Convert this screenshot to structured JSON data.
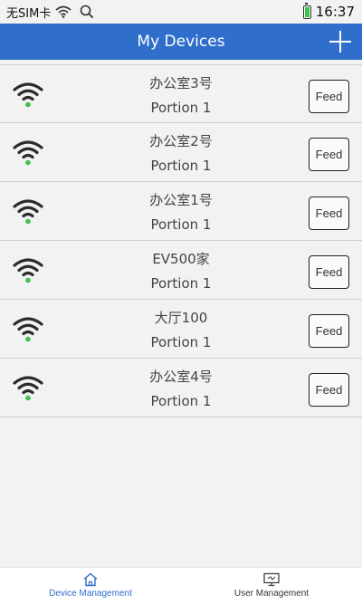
{
  "status_bar": {
    "carrier": "无SIM卡",
    "time": "16:37",
    "icons": [
      "wifi-icon",
      "search-icon",
      "battery-icon"
    ]
  },
  "header": {
    "title": "My Devices",
    "add_icon": "plus-icon"
  },
  "devices": [
    {
      "name": "办公室3号",
      "portion": "Portion 1",
      "feed_label": "Feed",
      "online_color": "#3cc24a"
    },
    {
      "name": "办公室2号",
      "portion": "Portion 1",
      "feed_label": "Feed",
      "online_color": "#3cc24a"
    },
    {
      "name": "办公室1号",
      "portion": "Portion 1",
      "feed_label": "Feed",
      "online_color": "#3cc24a"
    },
    {
      "name": "EV500家",
      "portion": "Portion 1",
      "feed_label": "Feed",
      "online_color": "#3cc24a"
    },
    {
      "name": "大厅100",
      "portion": "Portion 1",
      "feed_label": "Feed",
      "online_color": "#3cc24a"
    },
    {
      "name": "办公室4号",
      "portion": "Portion 1",
      "feed_label": "Feed",
      "online_color": "#3cc24a"
    }
  ],
  "bottom_nav": {
    "items": [
      {
        "label": "Device Management",
        "icon": "home-icon",
        "active": true
      },
      {
        "label": "User Management",
        "icon": "monitor-icon",
        "active": false
      }
    ]
  },
  "colors": {
    "accent": "#2f6ecb",
    "background": "#f2f2f2",
    "online": "#3cc24a"
  }
}
